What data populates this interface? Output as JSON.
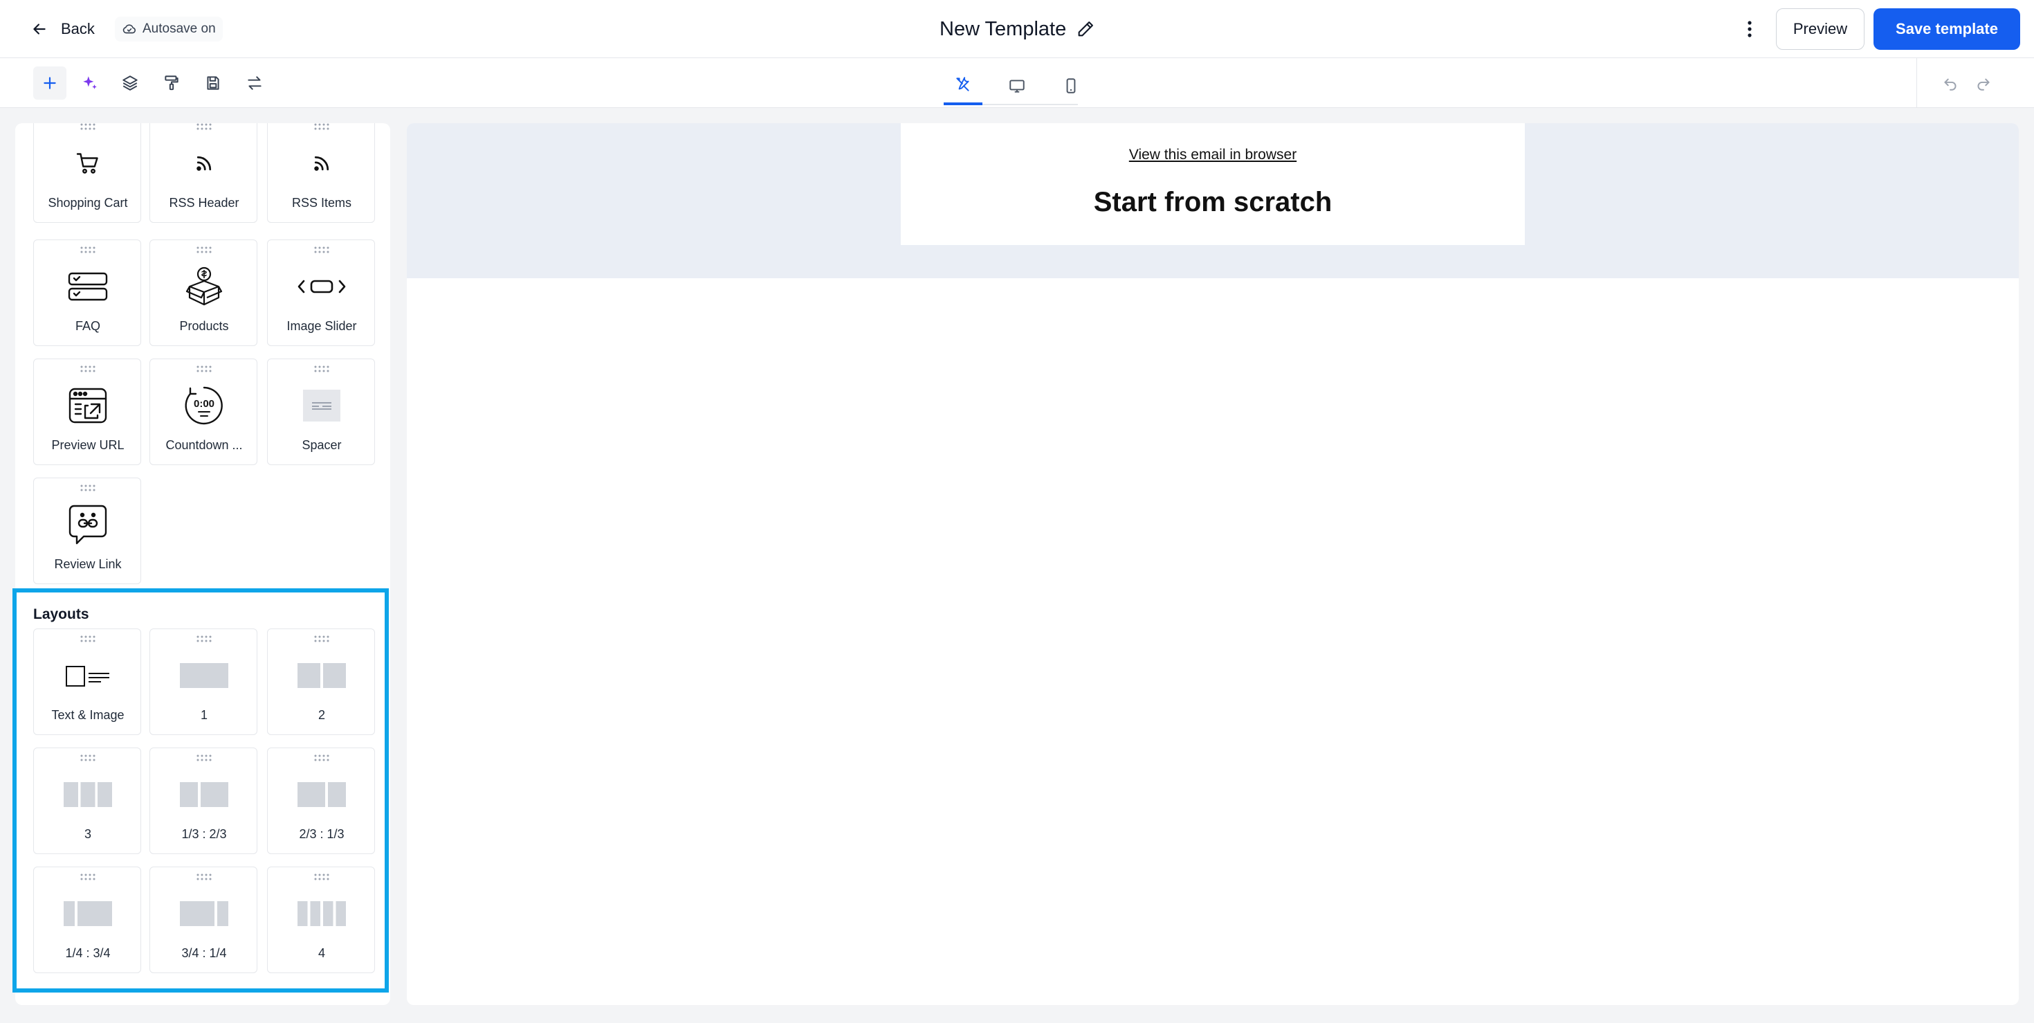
{
  "header": {
    "back_label": "Back",
    "autosave_label": "Autosave on",
    "title": "New Template",
    "preview_label": "Preview",
    "save_label": "Save template"
  },
  "colors": {
    "primary": "#155eef",
    "highlight": "#0ea5e9",
    "canvas_band": "#eaeef5"
  },
  "toolbar": {
    "tools": [
      "plus-icon",
      "sparkles-icon",
      "layers-icon",
      "paint-roller-icon",
      "save-icon",
      "swap-icon"
    ],
    "view_tabs": [
      "tools-icon",
      "desktop-icon",
      "mobile-icon"
    ],
    "history": [
      "undo-icon",
      "redo-icon"
    ]
  },
  "sidebar": {
    "elements": [
      {
        "label": "Shopping Cart",
        "icon": "shopping-cart-icon"
      },
      {
        "label": "RSS Header",
        "icon": "rss-icon"
      },
      {
        "label": "RSS Items",
        "icon": "rss-icon"
      },
      {
        "label": "FAQ",
        "icon": "faq-icon"
      },
      {
        "label": "Products",
        "icon": "products-icon"
      },
      {
        "label": "Image Slider",
        "icon": "image-slider-icon"
      },
      {
        "label": "Preview URL",
        "icon": "preview-url-icon"
      },
      {
        "label": "Countdown ...",
        "icon": "countdown-icon"
      },
      {
        "label": "Spacer",
        "icon": "spacer-icon"
      },
      {
        "label": "Review Link",
        "icon": "review-link-icon"
      }
    ],
    "layouts_title": "Layouts",
    "layouts": [
      {
        "label": "Text & Image"
      },
      {
        "label": "1"
      },
      {
        "label": "2"
      },
      {
        "label": "3"
      },
      {
        "label": "1/3 : 2/3"
      },
      {
        "label": "2/3 : 1/3"
      },
      {
        "label": "1/4 : 3/4"
      },
      {
        "label": "3/4 : 1/4"
      },
      {
        "label": "4"
      }
    ]
  },
  "canvas": {
    "view_link": "View this email in browser",
    "heading": "Start from scratch"
  }
}
